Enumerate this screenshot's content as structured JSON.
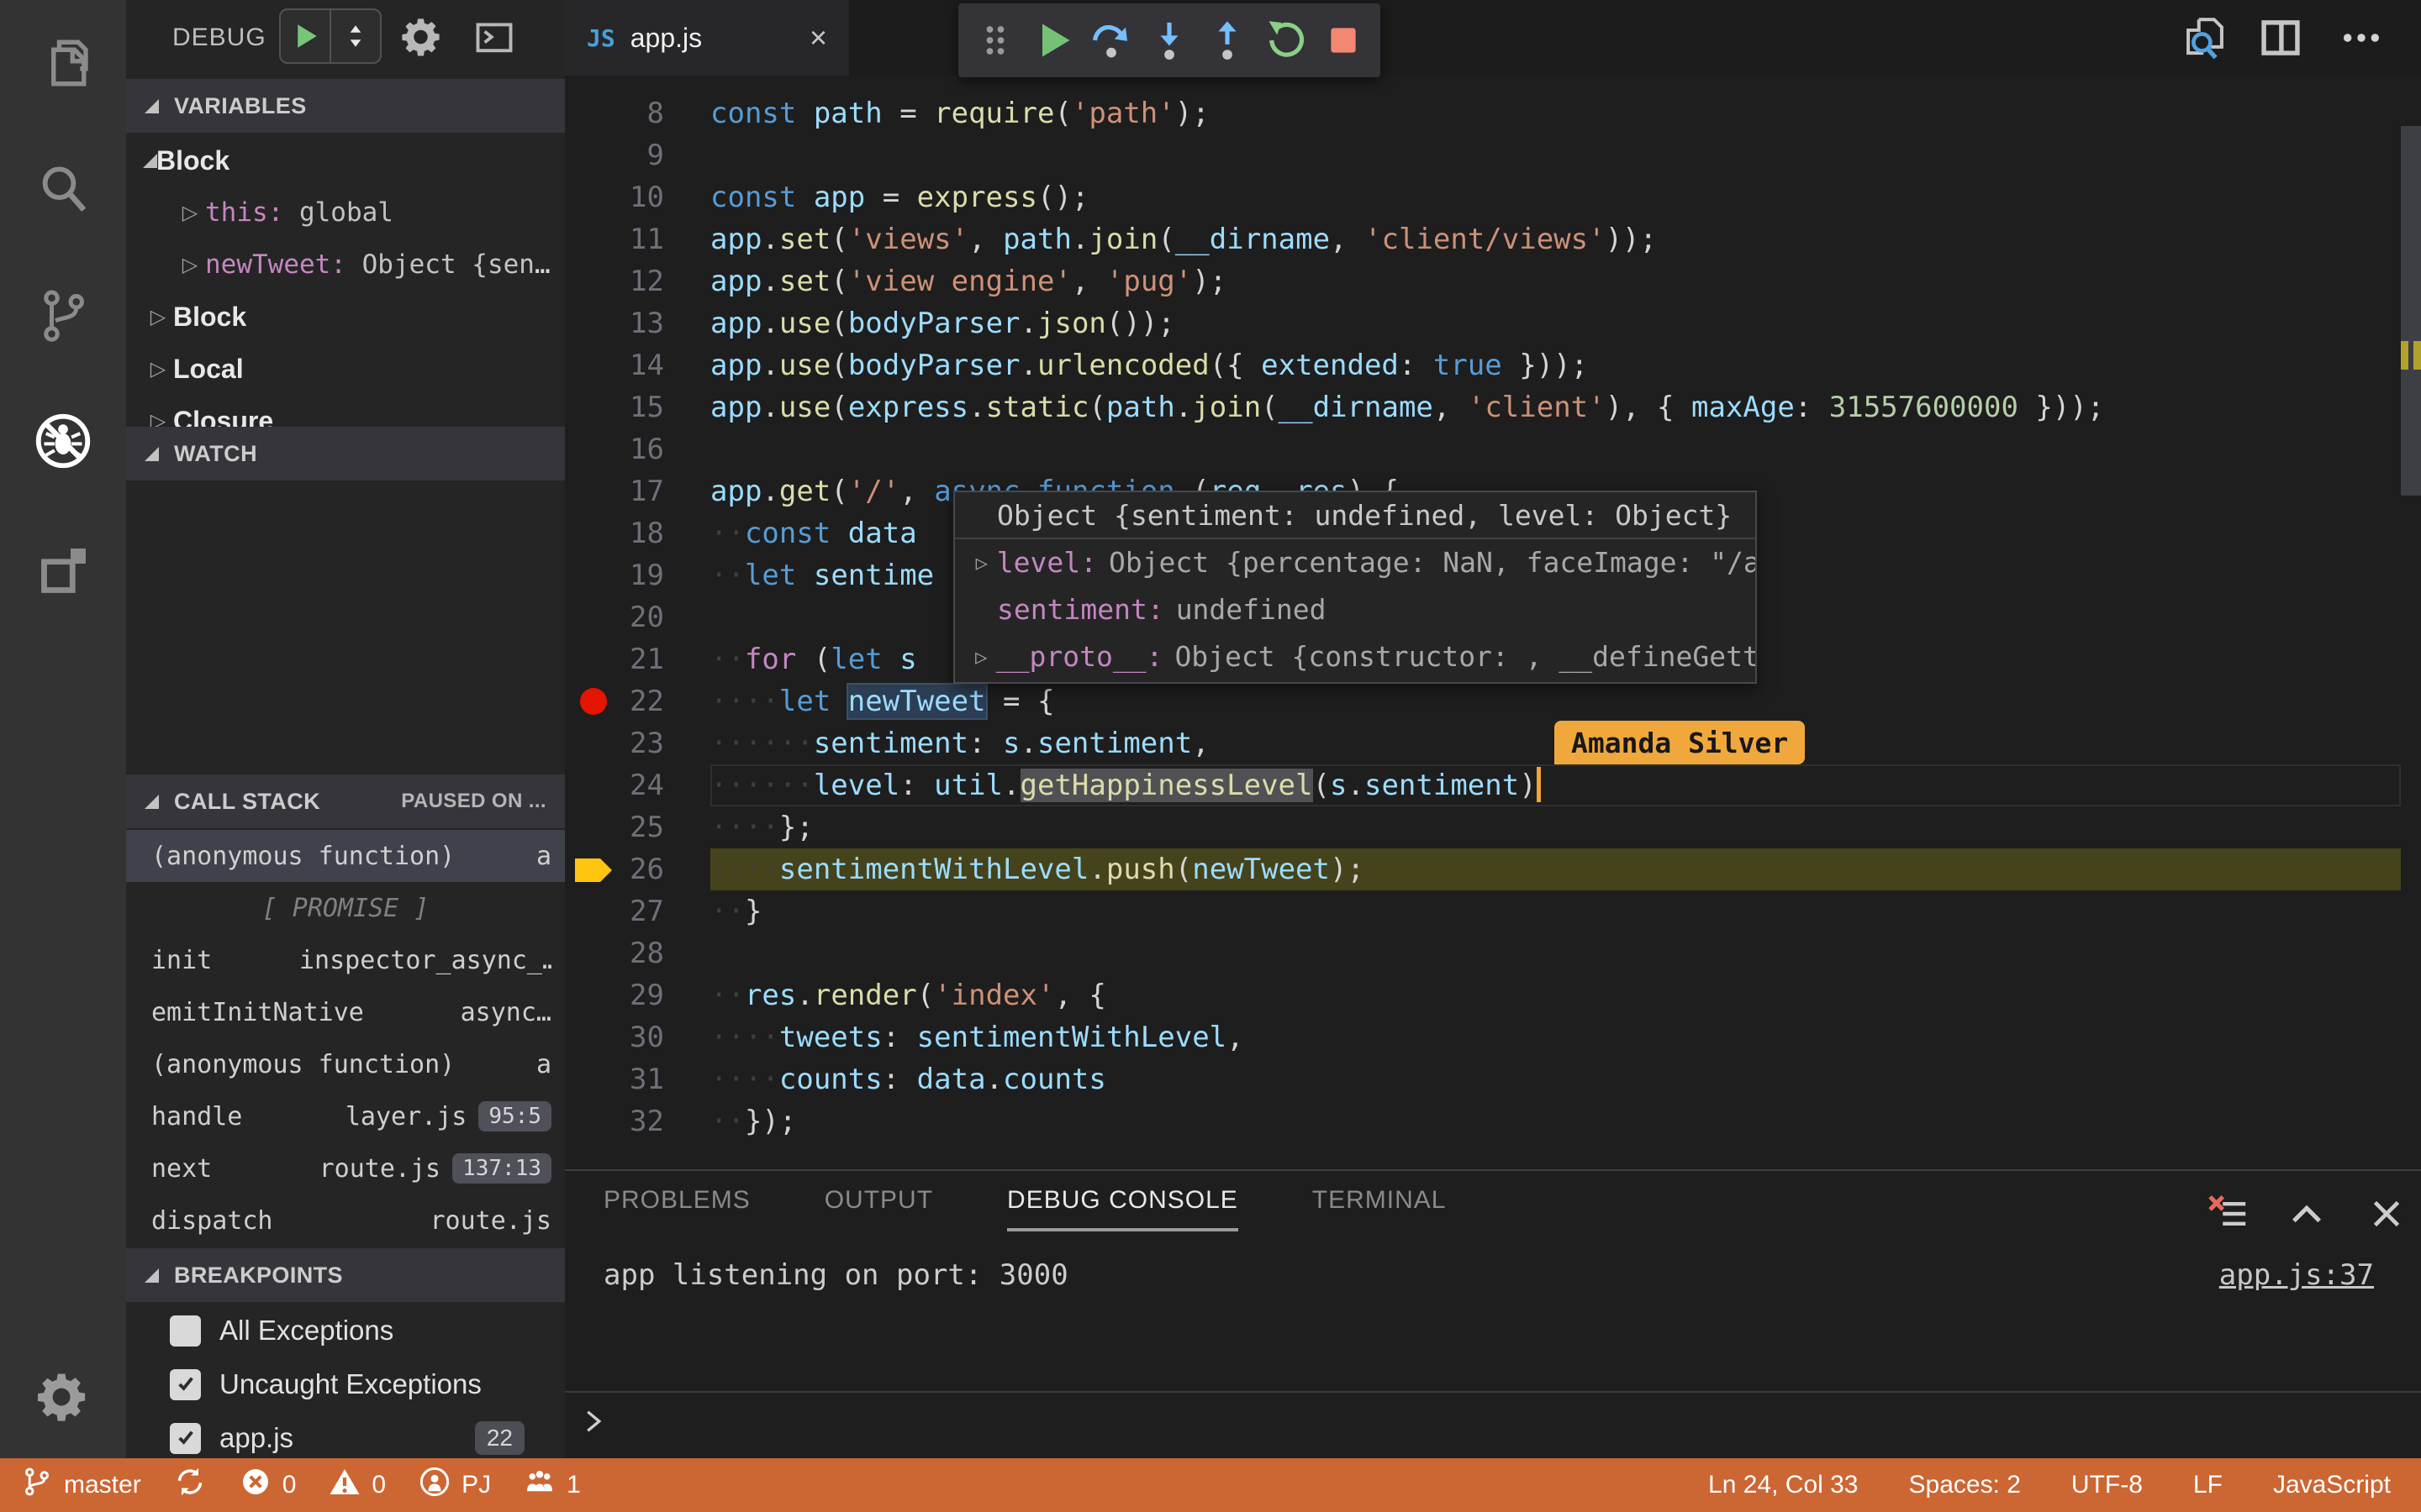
{
  "colors": {
    "status_bar_background": "#cc6633",
    "breakpoint_red": "#e51400",
    "execution_line_olive": "#45431b",
    "execution_arrow_yellow": "#ffc510",
    "collaborator_tag_orange": "#f0a83c",
    "keyword_blue": "#569cd6",
    "control_keyword_pink": "#c586c0",
    "variable_blue": "#9cdcfe",
    "function_yellow": "#dcdcaa",
    "string_salmon": "#ce9178",
    "number_green": "#b5cea8"
  },
  "activity_bar": {
    "items": [
      {
        "icon": "files-icon",
        "active": false
      },
      {
        "icon": "search-icon",
        "active": false
      },
      {
        "icon": "source-control-icon",
        "active": false
      },
      {
        "icon": "debug-icon",
        "active": true
      },
      {
        "icon": "extensions-icon",
        "active": false
      }
    ],
    "settings_icon": "gear-icon"
  },
  "sidebar": {
    "title": "DEBUG",
    "variables": {
      "header": "VARIABLES",
      "rows": [
        {
          "type": "scope",
          "label": "Block",
          "expanded": true
        },
        {
          "type": "var",
          "name": "this",
          "value": "global"
        },
        {
          "type": "var",
          "name": "newTweet",
          "value": "Object {sent…"
        },
        {
          "type": "scope",
          "label": "Block",
          "expanded": false
        },
        {
          "type": "scope",
          "label": "Local",
          "expanded": false
        },
        {
          "type": "scope",
          "label": "Closure",
          "expanded": false
        }
      ]
    },
    "watch": {
      "header": "WATCH"
    },
    "call_stack": {
      "header": "CALL STACK",
      "status": "PAUSED ON ...",
      "frames": [
        {
          "name": "(anonymous function)",
          "file": "a",
          "selected": true
        },
        {
          "separator": "[ PROMISE ]"
        },
        {
          "name": "init",
          "file": "inspector_async_…"
        },
        {
          "name": "emitInitNative",
          "file": "async…"
        },
        {
          "name": "(anonymous function)",
          "file": "a"
        },
        {
          "name": "handle",
          "file": "layer.js",
          "badge": "95:5"
        },
        {
          "name": "next",
          "file": "route.js",
          "badge": "137:13"
        },
        {
          "name": "dispatch",
          "file": "route.js"
        }
      ]
    },
    "breakpoints": {
      "header": "BREAKPOINTS",
      "items": [
        {
          "label": "All Exceptions",
          "checked": false
        },
        {
          "label": "Uncaught Exceptions",
          "checked": true
        },
        {
          "label": "app.js",
          "checked": true,
          "badge": "22"
        }
      ]
    }
  },
  "editor": {
    "tab": {
      "icon": "JS",
      "title": "app.js",
      "close": "×"
    },
    "toolbar": [
      "grip-icon",
      "continue-icon",
      "step-over-icon",
      "step-into-icon",
      "step-out-icon",
      "restart-icon",
      "stop-icon"
    ],
    "actions": [
      "search-file-icon",
      "split-editor-icon",
      "more-actions-icon"
    ],
    "breakpoint_line": 22,
    "execution_line": 26,
    "cursor_line": 24,
    "code": [
      {
        "n": 8,
        "ind": 0,
        "tk": [
          [
            "k",
            "const "
          ],
          [
            "v",
            "path"
          ],
          [
            "o",
            " = "
          ],
          [
            "f",
            "require"
          ],
          [
            "o",
            "("
          ],
          [
            "s",
            "'path'"
          ],
          [
            "o",
            ");"
          ]
        ]
      },
      {
        "n": 9,
        "ind": 0,
        "tk": []
      },
      {
        "n": 10,
        "ind": 0,
        "tk": [
          [
            "k",
            "const "
          ],
          [
            "v",
            "app"
          ],
          [
            "o",
            " = "
          ],
          [
            "f",
            "express"
          ],
          [
            "o",
            "();"
          ]
        ]
      },
      {
        "n": 11,
        "ind": 0,
        "tk": [
          [
            "v",
            "app"
          ],
          [
            "o",
            "."
          ],
          [
            "f",
            "set"
          ],
          [
            "o",
            "("
          ],
          [
            "s",
            "'views'"
          ],
          [
            "o",
            ", "
          ],
          [
            "v",
            "path"
          ],
          [
            "o",
            "."
          ],
          [
            "f",
            "join"
          ],
          [
            "o",
            "("
          ],
          [
            "v",
            "__dirname"
          ],
          [
            "o",
            ", "
          ],
          [
            "s",
            "'client/views'"
          ],
          [
            "o",
            "));"
          ]
        ]
      },
      {
        "n": 12,
        "ind": 0,
        "tk": [
          [
            "v",
            "app"
          ],
          [
            "o",
            "."
          ],
          [
            "f",
            "set"
          ],
          [
            "o",
            "("
          ],
          [
            "s",
            "'view engine'"
          ],
          [
            "o",
            ", "
          ],
          [
            "s",
            "'pug'"
          ],
          [
            "o",
            ");"
          ]
        ]
      },
      {
        "n": 13,
        "ind": 0,
        "tk": [
          [
            "v",
            "app"
          ],
          [
            "o",
            "."
          ],
          [
            "f",
            "use"
          ],
          [
            "o",
            "("
          ],
          [
            "v",
            "bodyParser"
          ],
          [
            "o",
            "."
          ],
          [
            "f",
            "json"
          ],
          [
            "o",
            "());"
          ]
        ]
      },
      {
        "n": 14,
        "ind": 0,
        "tk": [
          [
            "v",
            "app"
          ],
          [
            "o",
            "."
          ],
          [
            "f",
            "use"
          ],
          [
            "o",
            "("
          ],
          [
            "v",
            "bodyParser"
          ],
          [
            "o",
            "."
          ],
          [
            "f",
            "urlencoded"
          ],
          [
            "o",
            "({ "
          ],
          [
            "v",
            "extended"
          ],
          [
            "o",
            ": "
          ],
          [
            "k",
            "true"
          ],
          [
            "o",
            " }));"
          ]
        ]
      },
      {
        "n": 15,
        "ind": 0,
        "tk": [
          [
            "v",
            "app"
          ],
          [
            "o",
            "."
          ],
          [
            "f",
            "use"
          ],
          [
            "o",
            "("
          ],
          [
            "v",
            "express"
          ],
          [
            "o",
            "."
          ],
          [
            "f",
            "static"
          ],
          [
            "o",
            "("
          ],
          [
            "v",
            "path"
          ],
          [
            "o",
            "."
          ],
          [
            "f",
            "join"
          ],
          [
            "o",
            "("
          ],
          [
            "v",
            "__dirname"
          ],
          [
            "o",
            ", "
          ],
          [
            "s",
            "'client'"
          ],
          [
            "o",
            "), { "
          ],
          [
            "v",
            "maxAge"
          ],
          [
            "o",
            ": "
          ],
          [
            "n",
            "31557600000"
          ],
          [
            "o",
            " }));"
          ]
        ]
      },
      {
        "n": 16,
        "ind": 0,
        "tk": []
      },
      {
        "n": 17,
        "ind": 0,
        "tk": [
          [
            "v",
            "app"
          ],
          [
            "o",
            "."
          ],
          [
            "f",
            "get"
          ],
          [
            "o",
            "("
          ],
          [
            "s",
            "'/'"
          ],
          [
            "o",
            ", "
          ],
          [
            "k",
            "async "
          ],
          [
            "k",
            "function "
          ],
          [
            "o",
            "("
          ],
          [
            "v",
            "req"
          ],
          [
            "o",
            ", "
          ],
          [
            "v",
            "res"
          ],
          [
            "o",
            ") {"
          ]
        ]
      },
      {
        "n": 18,
        "ind": 2,
        "tk": [
          [
            "k",
            "const "
          ],
          [
            "v",
            "data"
          ]
        ]
      },
      {
        "n": 19,
        "ind": 2,
        "tk": [
          [
            "k",
            "let "
          ],
          [
            "v",
            "sentime"
          ]
        ]
      },
      {
        "n": 20,
        "ind": 0,
        "tk": []
      },
      {
        "n": 21,
        "ind": 2,
        "tk": [
          [
            "kc",
            "for "
          ],
          [
            "o",
            "("
          ],
          [
            "k",
            "let "
          ],
          [
            "v",
            "s"
          ]
        ]
      },
      {
        "n": 22,
        "ind": 4,
        "tk": [
          [
            "k",
            "let "
          ],
          [
            "vsel",
            "newTweet"
          ],
          [
            "o",
            " = {"
          ]
        ],
        "breakpoint": true
      },
      {
        "n": 23,
        "ind": 6,
        "tk": [
          [
            "v",
            "sentiment"
          ],
          [
            "o",
            ": "
          ],
          [
            "v",
            "s"
          ],
          [
            "o",
            "."
          ],
          [
            "v",
            "sentiment"
          ],
          [
            "o",
            ","
          ]
        ]
      },
      {
        "n": 24,
        "ind": 6,
        "tk": [
          [
            "v",
            "level"
          ],
          [
            "o",
            ": "
          ],
          [
            "v",
            "util"
          ],
          [
            "o",
            "."
          ],
          [
            "fhl",
            "getHappinessLevel"
          ],
          [
            "o",
            "("
          ],
          [
            "v",
            "s"
          ],
          [
            "o",
            "."
          ],
          [
            "v",
            "sentiment"
          ],
          [
            "o",
            ")"
          ]
        ],
        "caret": true,
        "cursorline": true
      },
      {
        "n": 25,
        "ind": 4,
        "tk": [
          [
            "o",
            "};"
          ]
        ]
      },
      {
        "n": 26,
        "ind": 4,
        "tk": [
          [
            "v",
            "sentimentWithLevel"
          ],
          [
            "o",
            "."
          ],
          [
            "f",
            "push"
          ],
          [
            "o",
            "("
          ],
          [
            "v",
            "newTweet"
          ],
          [
            "o",
            ");"
          ]
        ],
        "exec": true
      },
      {
        "n": 27,
        "ind": 2,
        "tk": [
          [
            "o",
            "}"
          ]
        ]
      },
      {
        "n": 28,
        "ind": 0,
        "tk": []
      },
      {
        "n": 29,
        "ind": 2,
        "tk": [
          [
            "v",
            "res"
          ],
          [
            "o",
            "."
          ],
          [
            "f",
            "render"
          ],
          [
            "o",
            "("
          ],
          [
            "s",
            "'index'"
          ],
          [
            "o",
            ", {"
          ]
        ]
      },
      {
        "n": 30,
        "ind": 4,
        "tk": [
          [
            "v",
            "tweets"
          ],
          [
            "o",
            ": "
          ],
          [
            "v",
            "sentimentWithLevel"
          ],
          [
            "o",
            ","
          ]
        ]
      },
      {
        "n": 31,
        "ind": 4,
        "tk": [
          [
            "v",
            "counts"
          ],
          [
            "o",
            ": "
          ],
          [
            "v",
            "data"
          ],
          [
            "o",
            "."
          ],
          [
            "v",
            "counts"
          ]
        ]
      },
      {
        "n": 32,
        "ind": 2,
        "tk": [
          [
            "o",
            "});"
          ]
        ]
      }
    ],
    "tooltip": {
      "title": "Object {sentiment: undefined, level: Object}",
      "rows": [
        {
          "expand": true,
          "name": "level:",
          "value": "Object {percentage: NaN, faceImage: \"/a"
        },
        {
          "expand": false,
          "name": "sentiment:",
          "value": "undefined"
        },
        {
          "expand": true,
          "name": "__proto__:",
          "value": "Object {constructor: , __defineGette"
        }
      ]
    },
    "collaborator": {
      "name": "Amanda Silver"
    }
  },
  "panel": {
    "tabs": [
      {
        "label": "PROBLEMS",
        "active": false
      },
      {
        "label": "OUTPUT",
        "active": false
      },
      {
        "label": "DEBUG CONSOLE",
        "active": true
      },
      {
        "label": "TERMINAL",
        "active": false
      }
    ],
    "icons": [
      "clear-console-icon",
      "collapse-panel-icon",
      "close-panel-icon"
    ],
    "output_line": "app listening on port: 3000",
    "source_link": "app.js:37"
  },
  "status_bar": {
    "left": [
      {
        "icon": "git-branch-icon",
        "label": "master"
      },
      {
        "icon": "sync-icon",
        "label": ""
      },
      {
        "icon": "error-icon",
        "label": "0"
      },
      {
        "icon": "warning-icon",
        "label": "0"
      },
      {
        "icon": "live-share-icon",
        "label": "PJ"
      },
      {
        "icon": "participants-icon",
        "label": "1"
      }
    ],
    "right": [
      {
        "label": "Ln 24, Col 33"
      },
      {
        "label": "Spaces: 2"
      },
      {
        "label": "UTF-8"
      },
      {
        "label": "LF"
      },
      {
        "label": "JavaScript"
      }
    ]
  }
}
